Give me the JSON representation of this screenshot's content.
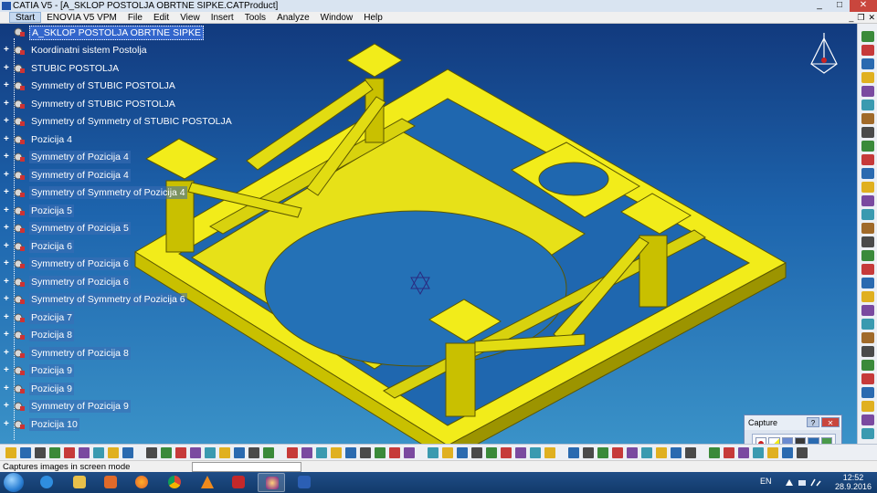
{
  "window": {
    "title": "CATIA V5 - [A_SKLOP POSTOLJA OBRTNE SIPKE.CATProduct]",
    "minimize_glyph": "_",
    "maximize_glyph": "□",
    "close_glyph": "✕"
  },
  "menubar": {
    "items": [
      "Start",
      "ENOVIA V5 VPM",
      "File",
      "Edit",
      "View",
      "Insert",
      "Tools",
      "Analyze",
      "Window",
      "Help"
    ],
    "mdi_minimize": "_",
    "mdi_restore": "❐",
    "mdi_close": "✕"
  },
  "tree": {
    "root": "A_SKLOP POSTOLJA OBRTNE SIPKE",
    "nodes": [
      {
        "label": "Koordinatni sistem Postolja",
        "selected": false
      },
      {
        "label": "STUBIC POSTOLJA",
        "selected": false
      },
      {
        "label": "Symmetry of STUBIC POSTOLJA",
        "selected": false
      },
      {
        "label": "Symmetry of STUBIC POSTOLJA",
        "selected": false
      },
      {
        "label": "Symmetry of Symmetry of STUBIC POSTOLJA",
        "selected": false
      },
      {
        "label": "Pozicija 4",
        "selected": false
      },
      {
        "label": "Symmetry of Pozicija 4",
        "selected": true
      },
      {
        "label": "Symmetry of Pozicija 4",
        "selected": true
      },
      {
        "label": "Symmetry of Symmetry of Pozicija 4",
        "selected": true
      },
      {
        "label": "Pozicija 5",
        "selected": true
      },
      {
        "label": "Symmetry of Pozicija 5",
        "selected": true
      },
      {
        "label": "Pozicija 6",
        "selected": true
      },
      {
        "label": "Symmetry of Pozicija 6",
        "selected": true
      },
      {
        "label": "Symmetry of Pozicija 6",
        "selected": true
      },
      {
        "label": "Symmetry of Symmetry of Pozicija 6",
        "selected": true
      },
      {
        "label": "Pozicija 7",
        "selected": true
      },
      {
        "label": "Pozicija 8",
        "selected": true
      },
      {
        "label": "Symmetry of Pozicija 8",
        "selected": true
      },
      {
        "label": "Pozicija 9",
        "selected": true
      },
      {
        "label": "Pozicija 9",
        "selected": true
      },
      {
        "label": "Symmetry of Pozicija 9",
        "selected": true
      },
      {
        "label": "Pozicija 10",
        "selected": true
      }
    ]
  },
  "capture_panel": {
    "title": "Capture",
    "help_glyph": "?",
    "close_glyph": "✕"
  },
  "status": {
    "message": "Captures images in screen mode"
  },
  "taskbar": {
    "language": "EN",
    "time": "12:52",
    "date": "28.9.2016"
  },
  "colors": {
    "model_yellow": "#f2ec1a",
    "model_yellow_dark": "#c9c000",
    "model_yellow_shadow": "#9c9400",
    "viewport_top": "#123a7e",
    "viewport_bottom": "#3a92c8",
    "tree_selection": "#3c6eb4",
    "tree_root_highlight": "#3366cc"
  },
  "icons": {
    "tree_node": "part-gear-icon",
    "compass": "compass-icon",
    "origin": "origin-axis-icon",
    "capture_record": "record-icon"
  }
}
